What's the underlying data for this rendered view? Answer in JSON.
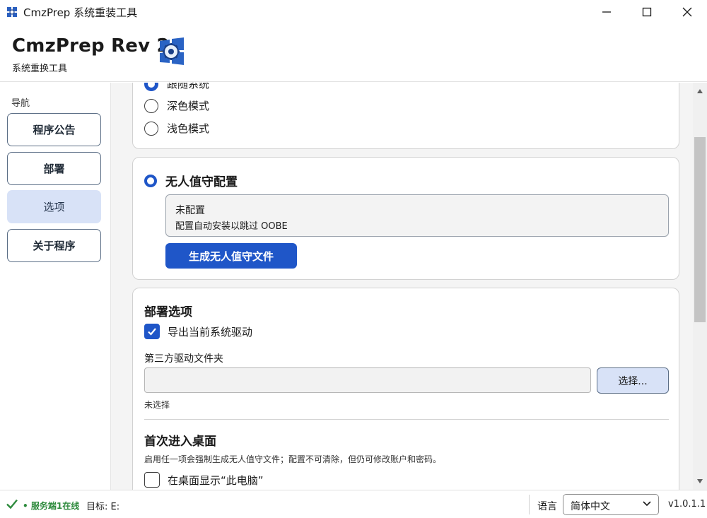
{
  "window": {
    "title": "CmzPrep 系统重装工具"
  },
  "header": {
    "title": "CmzPrep Rev 2",
    "subtitle": "系统重换工具"
  },
  "sidebar": {
    "label": "导航",
    "items": [
      {
        "label": "程序公告",
        "active": false
      },
      {
        "label": "部署",
        "active": false
      },
      {
        "label": "选项",
        "active": true
      },
      {
        "label": "关于程序",
        "active": false
      }
    ]
  },
  "theme_card": {
    "options": [
      {
        "label": "跟随系统",
        "selected": true
      },
      {
        "label": "深色模式",
        "selected": false
      },
      {
        "label": "浅色模式",
        "selected": false
      }
    ]
  },
  "unattended_card": {
    "heading": "无人值守配置",
    "info_title": "未配置",
    "info_desc": "配置自动安装以跳过 OOBE",
    "button_label": "生成无人值守文件"
  },
  "deploy_card": {
    "heading": "部署选项",
    "export_drivers_label": "导出当前系统驱动",
    "export_drivers_checked": true,
    "driver_folder_label": "第三方驱动文件夹",
    "driver_folder_value": "",
    "select_button_label": "选择...",
    "driver_folder_status": "未选择",
    "desktop_heading": "首次进入桌面",
    "desktop_desc": "启用任一项会强制生成无人值守文件；配置不可清除，但仍可修改账户和密码。",
    "show_pc_label": "在桌面显示“此电脑”",
    "show_pc_checked": false
  },
  "statusbar": {
    "online_text": "• 服务端1在线",
    "target_text": "目标: E:",
    "language_label": "语言",
    "language_value": "简体中文",
    "version": "v1.0.1.1"
  },
  "colors": {
    "accent": "#1f56c8",
    "nav_active_bg": "#d8e2f7",
    "online_green": "#2e8b3d"
  }
}
